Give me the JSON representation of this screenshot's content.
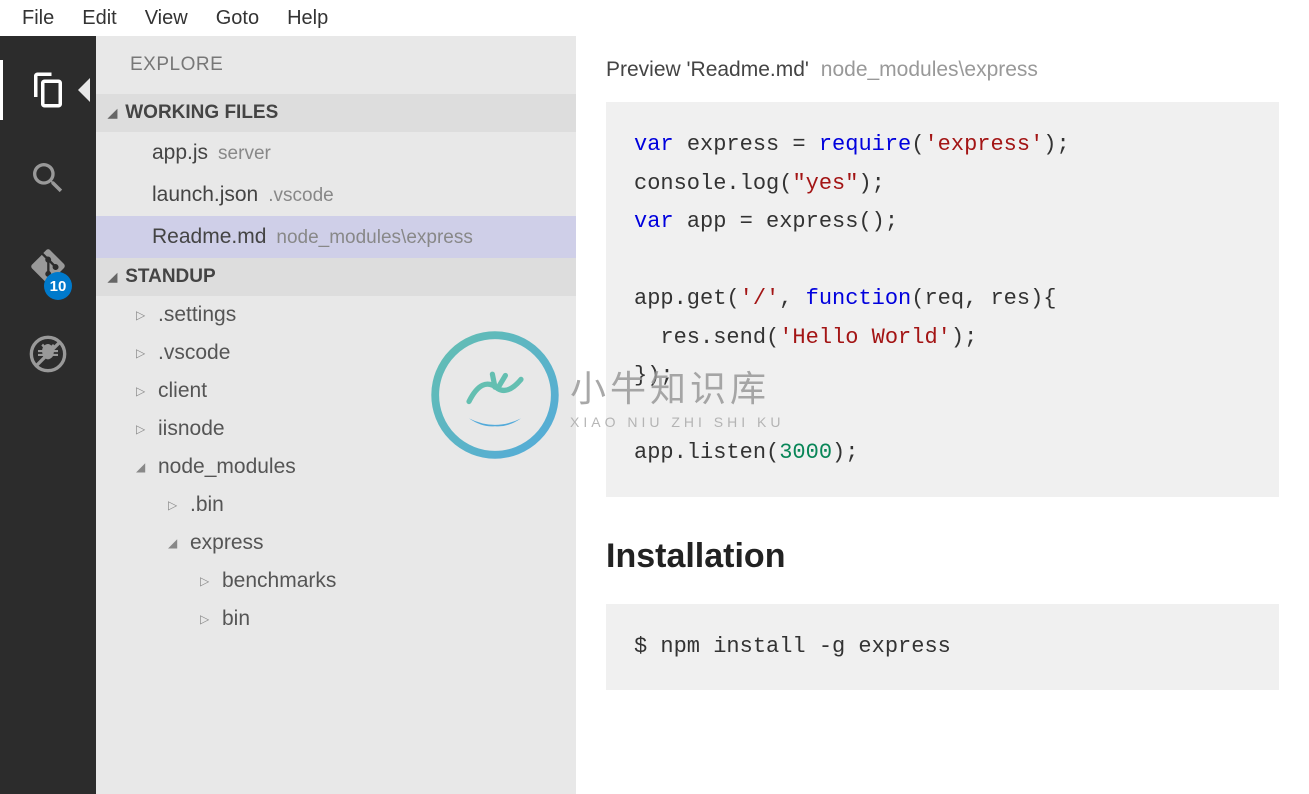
{
  "menubar": [
    "File",
    "Edit",
    "View",
    "Goto",
    "Help"
  ],
  "activitybar": {
    "badge_count": "10"
  },
  "sidebar": {
    "title": "EXPLORE",
    "sections": {
      "working_files": {
        "label": "WORKING FILES",
        "items": [
          {
            "name": "app.js",
            "path": "server"
          },
          {
            "name": "launch.json",
            "path": ".vscode"
          },
          {
            "name": "Readme.md",
            "path": "node_modules\\express",
            "selected": true
          }
        ]
      },
      "standup": {
        "label": "STANDUP",
        "items": [
          {
            "name": ".settings",
            "depth": 1,
            "open": false
          },
          {
            "name": ".vscode",
            "depth": 1,
            "open": false
          },
          {
            "name": "client",
            "depth": 1,
            "open": false
          },
          {
            "name": "iisnode",
            "depth": 1,
            "open": false
          },
          {
            "name": "node_modules",
            "depth": 1,
            "open": true
          },
          {
            "name": ".bin",
            "depth": 2,
            "open": false
          },
          {
            "name": "express",
            "depth": 2,
            "open": true
          },
          {
            "name": "benchmarks",
            "depth": 3,
            "open": false
          },
          {
            "name": "bin",
            "depth": 3,
            "open": false
          }
        ]
      }
    }
  },
  "editor": {
    "tab_prefix": "Preview 'Readme.md'",
    "tab_path": "node_modules\\express",
    "code_tokens": [
      {
        "t": "var ",
        "c": "kw"
      },
      {
        "t": "express = "
      },
      {
        "t": "require",
        "c": "fn"
      },
      {
        "t": "("
      },
      {
        "t": "'express'",
        "c": "str"
      },
      {
        "t": ");\n"
      },
      {
        "t": "console.log("
      },
      {
        "t": "\"yes\"",
        "c": "str"
      },
      {
        "t": ");\n"
      },
      {
        "t": "var ",
        "c": "kw"
      },
      {
        "t": "app = express();\n\n"
      },
      {
        "t": "app.get("
      },
      {
        "t": "'/'",
        "c": "str"
      },
      {
        "t": ", "
      },
      {
        "t": "function",
        "c": "kw"
      },
      {
        "t": "(req, res){\n"
      },
      {
        "t": "  res.send("
      },
      {
        "t": "'Hello World'",
        "c": "str"
      },
      {
        "t": ");\n"
      },
      {
        "t": "});\n\n"
      },
      {
        "t": "app.listen("
      },
      {
        "t": "3000",
        "c": "num"
      },
      {
        "t": ");"
      }
    ],
    "heading": "Installation",
    "install_cmd": "$ npm install -g express"
  },
  "watermark": {
    "cn": "小牛知识库",
    "en": "XIAO NIU ZHI SHI KU"
  }
}
